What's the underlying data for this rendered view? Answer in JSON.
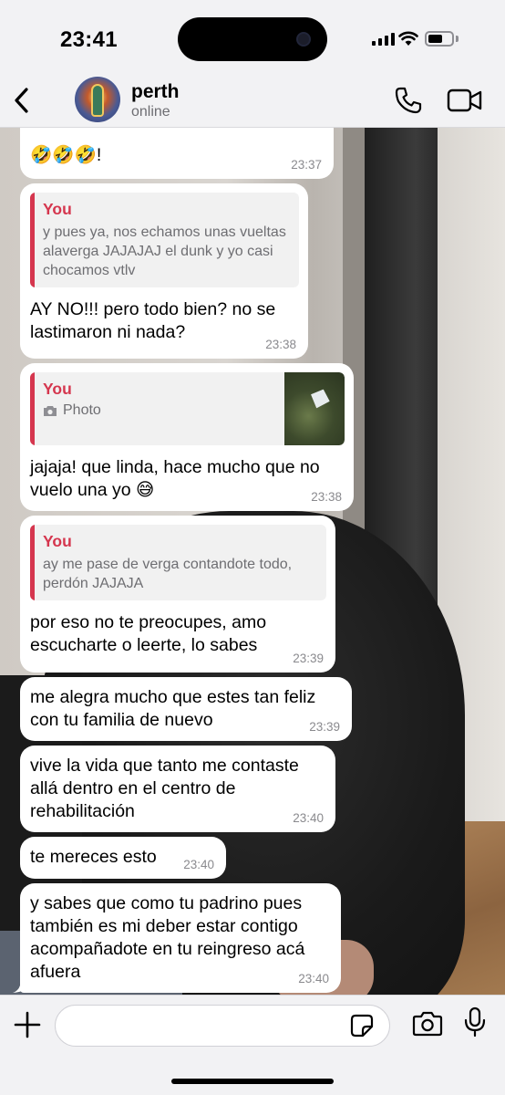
{
  "status_bar": {
    "time": "23:41"
  },
  "header": {
    "contact_name": "perth",
    "contact_status": "online"
  },
  "messages": [
    {
      "text": "🤣🤣🤣!",
      "time": "23:37"
    },
    {
      "quote": {
        "author": "You",
        "text": "y pues ya, nos echamos unas vueltas alaverga JAJAJAJ el dunk y yo casi chocamos vtlv"
      },
      "text": "AY NO!!! pero todo bien? no se lastimaron ni nada?",
      "time": "23:38"
    },
    {
      "quote": {
        "author": "You",
        "text": "Photo"
      },
      "text": "jajaja! que linda, hace mucho que no vuelo una yo 😅",
      "time": "23:38"
    },
    {
      "quote": {
        "author": "You",
        "text": "ay me pase de verga contandote todo, perdón JAJAJA"
      },
      "text": "por eso no te preocupes, amo escucharte o leerte, lo sabes",
      "time": "23:39"
    },
    {
      "text": "me alegra mucho que estes tan feliz con tu familia de nuevo",
      "time": "23:39"
    },
    {
      "text": "vive la vida que tanto me contaste allá dentro en el centro de rehabilitación",
      "time": "23:40"
    },
    {
      "text": "te mereces esto",
      "time": "23:40"
    },
    {
      "text": "y sabes que como tu padrino pues también es mi deber estar contigo acompañadote en tu reingreso acá afuera",
      "time": "23:40"
    }
  ],
  "composer": {
    "placeholder": ""
  },
  "icons": {
    "back": "chevron-left-icon",
    "call": "phone-icon",
    "video": "video-camera-icon",
    "attach": "plus-icon",
    "sticker": "sticker-icon",
    "camera": "camera-icon",
    "mic": "microphone-icon"
  },
  "colors": {
    "quote_accent": "#d5364e",
    "bubble": "#ffffff",
    "bar": "#f2f2f4"
  }
}
